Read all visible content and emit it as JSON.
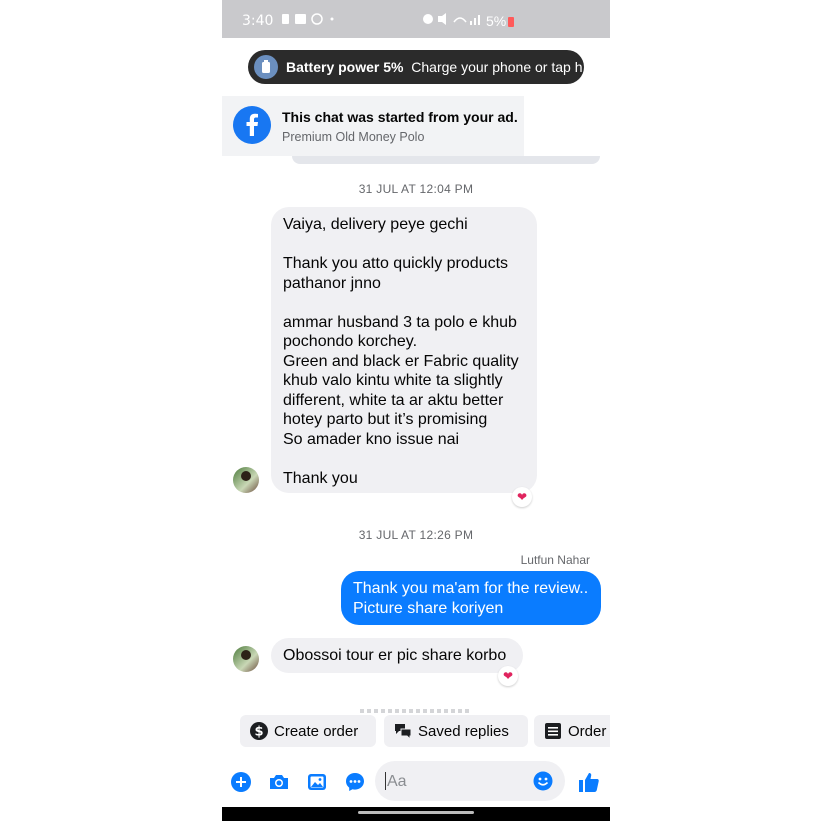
{
  "status_bar": {
    "time": "3:40",
    "battery": "5%"
  },
  "toast": {
    "bold": "Battery power 5%",
    "text": "Charge your phone or tap h..."
  },
  "ad_banner": {
    "title": "This chat was started from your ad.",
    "subtitle": "Premium Old Money Polo"
  },
  "timestamps": [
    "31 JUL AT 12:04 PM",
    "31 JUL AT 12:26 PM"
  ],
  "messages": [
    {
      "text": "Vaiya,  delivery peye gechi\n\nThank you atto quickly products\npathanor jnno\n\n ammar husband 3 ta polo e khub\npochondo korchey.\nGreen and black er Fabric quality\nkhub valo kintu white ta slightly\ndifferent, white ta  ar aktu better\nhotey parto but it’s promising\nSo amader kno issue nai\n\nThank you",
      "reaction": "heart"
    },
    {
      "sender": "Lutfun Nahar",
      "text": "Thank you ma'am for the review..\nPicture share koriyen"
    },
    {
      "text": "Obossoi tour er pic share korbo",
      "reaction": "heart"
    }
  ],
  "quick_actions": [
    "Create order",
    "Saved replies",
    "Order"
  ],
  "composer": {
    "placeholder": "Aa"
  },
  "colors": {
    "accent": "#0a7cff",
    "facebook_blue": "#1877f2",
    "incoming_bubble": "#f0f0f3"
  }
}
